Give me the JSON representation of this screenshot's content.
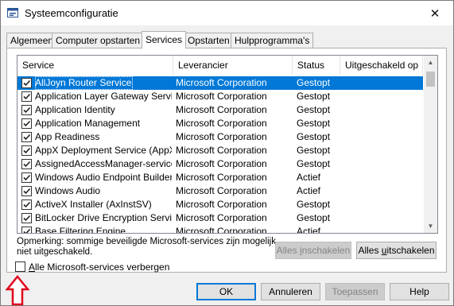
{
  "window": {
    "title": "Systeemconfiguratie",
    "close_glyph": "✕"
  },
  "tabs": [
    {
      "label": "Algemeen",
      "active": false
    },
    {
      "label": "Computer opstarten",
      "active": false
    },
    {
      "label": "Services",
      "active": true
    },
    {
      "label": "Opstarten",
      "active": false
    },
    {
      "label": "Hulpprogramma's",
      "active": false
    }
  ],
  "services_list": {
    "columns": [
      "Service",
      "Leverancier",
      "Status",
      "Uitgeschakeld op"
    ],
    "rows": [
      {
        "name": "AllJoyn Router Service",
        "vendor": "Microsoft Corporation",
        "status": "Gestopt",
        "disabled_on": "",
        "checked": true,
        "selected": true
      },
      {
        "name": "Application Layer Gateway Service",
        "vendor": "Microsoft Corporation",
        "status": "Gestopt",
        "disabled_on": "",
        "checked": true,
        "selected": false
      },
      {
        "name": "Application Identity",
        "vendor": "Microsoft Corporation",
        "status": "Gestopt",
        "disabled_on": "",
        "checked": true,
        "selected": false
      },
      {
        "name": "Application Management",
        "vendor": "Microsoft Corporation",
        "status": "Gestopt",
        "disabled_on": "",
        "checked": true,
        "selected": false
      },
      {
        "name": "App Readiness",
        "vendor": "Microsoft Corporation",
        "status": "Gestopt",
        "disabled_on": "",
        "checked": true,
        "selected": false
      },
      {
        "name": "AppX Deployment Service (AppX...",
        "vendor": "Microsoft Corporation",
        "status": "Gestopt",
        "disabled_on": "",
        "checked": true,
        "selected": false
      },
      {
        "name": "AssignedAccessManager-service",
        "vendor": "Microsoft Corporation",
        "status": "Gestopt",
        "disabled_on": "",
        "checked": true,
        "selected": false
      },
      {
        "name": "Windows Audio Endpoint Builder",
        "vendor": "Microsoft Corporation",
        "status": "Actief",
        "disabled_on": "",
        "checked": true,
        "selected": false
      },
      {
        "name": "Windows Audio",
        "vendor": "Microsoft Corporation",
        "status": "Actief",
        "disabled_on": "",
        "checked": true,
        "selected": false
      },
      {
        "name": "ActiveX Installer (AxInstSV)",
        "vendor": "Microsoft Corporation",
        "status": "Gestopt",
        "disabled_on": "",
        "checked": true,
        "selected": false
      },
      {
        "name": "BitLocker Drive Encryption Service",
        "vendor": "Microsoft Corporation",
        "status": "Gestopt",
        "disabled_on": "",
        "checked": true,
        "selected": false
      },
      {
        "name": "Base Filtering Engine",
        "vendor": "Microsoft Corporation",
        "status": "Actief",
        "disabled_on": "",
        "checked": true,
        "selected": false
      }
    ]
  },
  "note": "Opmerking: sommige beveiligde Microsoft-services zijn mogelijk niet uitgeschakeld.",
  "enable_all_button": {
    "pre": "Alles ",
    "key": "i",
    "post": "nschakelen",
    "enabled": false
  },
  "disable_all_button": {
    "pre": "Alles ",
    "key": "u",
    "post": "itschakelen",
    "enabled": true
  },
  "hide_ms_checkbox": {
    "key": "A",
    "rest": "lle Microsoft-services verbergen",
    "checked": false
  },
  "footer": {
    "ok": "OK",
    "cancel": "Annuleren",
    "apply": "Toepassen",
    "help": "Help"
  },
  "colors": {
    "selection": "#0078d7",
    "arrow": "#e0001b"
  },
  "icons": [
    "app-icon",
    "close-icon",
    "checkbox-icon",
    "scroll-up-icon",
    "scroll-down-icon",
    "red-arrow-icon"
  ]
}
